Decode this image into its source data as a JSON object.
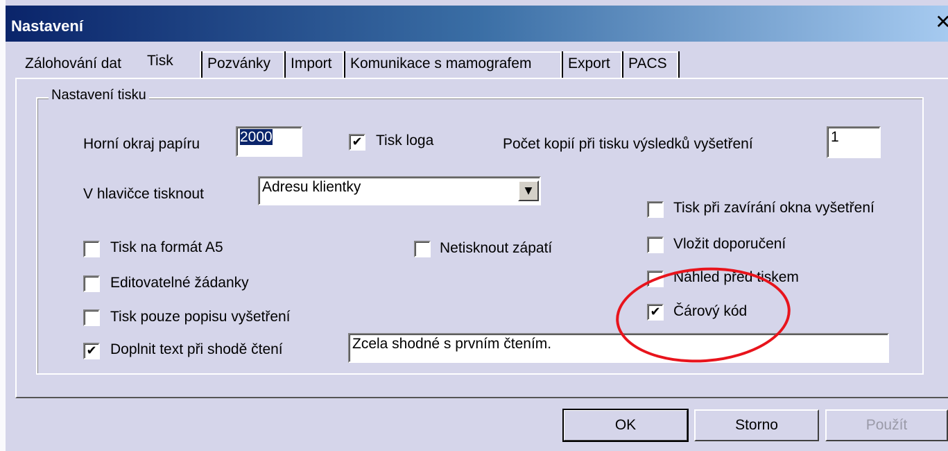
{
  "window": {
    "title": "Nastavení",
    "close_label": "✕"
  },
  "tabs": [
    {
      "label": "Zálohování dat"
    },
    {
      "label": "Tisk",
      "active": true
    },
    {
      "label": "Pozvánky"
    },
    {
      "label": "Import"
    },
    {
      "label": "Komunikace s mamografem"
    },
    {
      "label": "Export"
    },
    {
      "label": "PACS"
    }
  ],
  "group": {
    "title": "Nastavení tisku"
  },
  "fields": {
    "paper_top_margin": {
      "label": "Horní okraj papíru",
      "value": "2000"
    },
    "print_logo": {
      "label": "Tisk loga",
      "checked": true
    },
    "copies": {
      "label": "Počet kopií při tisku výsledků vyšetření",
      "value": "1"
    },
    "header": {
      "label": "V hlavičce tisknout",
      "value": "Adresu klientky"
    },
    "repeat_text": {
      "value": "Zcela shodné s prvním čtením."
    }
  },
  "checkboxes": {
    "print_on_close": {
      "label": "Tisk při zavírání okna vyšetření",
      "checked": false
    },
    "format_a5": {
      "label": "Tisk na formát A5",
      "checked": false
    },
    "no_footer": {
      "label": "Netisknout zápatí",
      "checked": false
    },
    "insert_recommendation": {
      "label": "Vložit doporučení",
      "checked": false
    },
    "editable_requests": {
      "label": "Editovatelné žádanky",
      "checked": false
    },
    "print_preview": {
      "label": "Náhled před tiskem",
      "checked": false
    },
    "description_only": {
      "label": "Tisk pouze popisu vyšetření",
      "checked": false
    },
    "barcode": {
      "label": "Čárový kód",
      "checked": true
    },
    "fill_text": {
      "label": "Doplnit text při shodě čtení",
      "checked": true
    }
  },
  "buttons": {
    "ok": "OK",
    "cancel": "Storno",
    "apply": "Použít"
  },
  "glyphs": {
    "check": "✔",
    "dropdown": "▼"
  },
  "colors": {
    "title_bar_start": "#0a246a",
    "title_bar_end": "#a6caf0",
    "annotation": "#e8141c",
    "background": "#d5d5ea"
  }
}
